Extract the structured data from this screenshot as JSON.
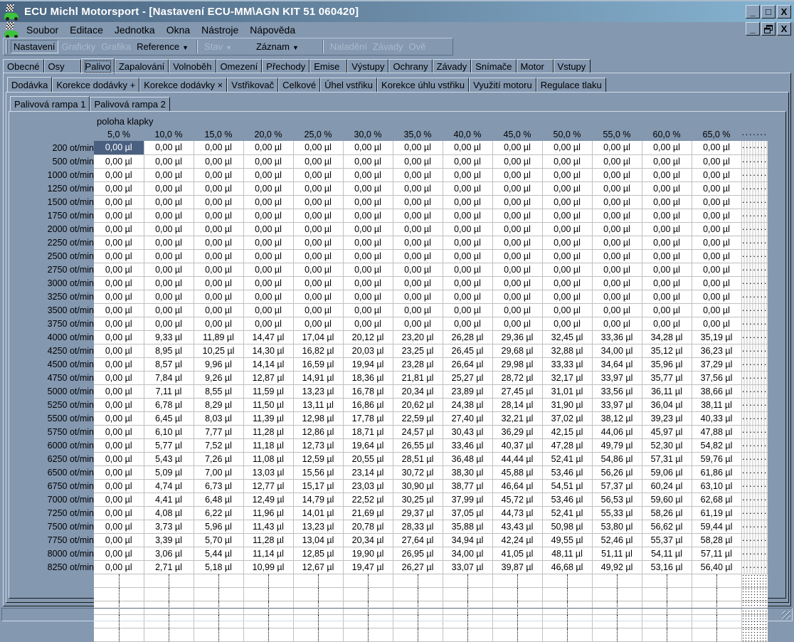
{
  "window": {
    "title": "ECU Michl Motorsport - [Nastavení ECU-MM\\AGN KIT 51 060420]",
    "controls": {
      "minimize": "_",
      "maximize": "□",
      "close": "X",
      "restore": "🗗"
    }
  },
  "menu": [
    "Soubor",
    "Editace",
    "Jednotka",
    "Okna",
    "Nástroje",
    "Nápověda"
  ],
  "toolbar": {
    "items": [
      {
        "label": "Nastavení",
        "state": "active"
      },
      {
        "label": "Graficky",
        "state": "disabled"
      },
      {
        "label": "Grafika",
        "state": "disabled"
      },
      {
        "label": "Reference",
        "state": "normal",
        "dropdown": true
      },
      {
        "label": "Stav",
        "state": "disabled",
        "dropdown": true
      },
      {
        "label": "Záznam",
        "state": "normal",
        "dropdown": true
      },
      {
        "label": "Naladění",
        "state": "disabled"
      },
      {
        "label": "Závady",
        "state": "disabled"
      },
      {
        "label": "Ově",
        "state": "disabled"
      }
    ],
    "dropdown_glyph": "▼"
  },
  "main_tabs": [
    "Obecné",
    "Osy",
    "Palivo",
    "Zapalování",
    "Volnoběh",
    "Omezení",
    "Přechody",
    "Emise",
    "Výstupy",
    "Ochrany",
    "Závady",
    "Snímače",
    "Motor",
    "Vstupy"
  ],
  "main_tab_active": "Palivo",
  "sub_tabs": [
    "Dodávka",
    "Korekce dodávky +",
    "Korekce dodávky ×",
    "Vstřikovač",
    "Celkové",
    "Úhel vstřiku",
    "Korekce úhlu vstřiku",
    "Využití motoru",
    "Regulace tlaku"
  ],
  "sub_tab_active": "Dodávka",
  "rail_tabs": [
    "Palivová rampa 1",
    "Palivová rampa 2"
  ],
  "rail_tab_active": "Palivová rampa 1",
  "table": {
    "column_axis_label": "poloha klapky",
    "columns": [
      "5,0 %",
      "10,0 %",
      "15,0 %",
      "20,0 %",
      "25,0 %",
      "30,0 %",
      "35,0 %",
      "40,0 %",
      "45,0 %",
      "50,0 %",
      "55,0 %",
      "60,0 %",
      "65,0 %"
    ],
    "more_columns_indicator": "·······",
    "more_rows_indicator": "⋮",
    "unit": "µl",
    "selected_cell": {
      "row": 0,
      "col": 0
    },
    "rows": [
      {
        "rpm": "200 ot/min",
        "values": [
          "0,00 µl",
          "0,00 µl",
          "0,00 µl",
          "0,00 µl",
          "0,00 µl",
          "0,00 µl",
          "0,00 µl",
          "0,00 µl",
          "0,00 µl",
          "0,00 µl",
          "0,00 µl",
          "0,00 µl",
          "0,00 µl"
        ]
      },
      {
        "rpm": "500 ot/min",
        "values": [
          "0,00 µl",
          "0,00 µl",
          "0,00 µl",
          "0,00 µl",
          "0,00 µl",
          "0,00 µl",
          "0,00 µl",
          "0,00 µl",
          "0,00 µl",
          "0,00 µl",
          "0,00 µl",
          "0,00 µl",
          "0,00 µl"
        ]
      },
      {
        "rpm": "1000 ot/min",
        "values": [
          "0,00 µl",
          "0,00 µl",
          "0,00 µl",
          "0,00 µl",
          "0,00 µl",
          "0,00 µl",
          "0,00 µl",
          "0,00 µl",
          "0,00 µl",
          "0,00 µl",
          "0,00 µl",
          "0,00 µl",
          "0,00 µl"
        ]
      },
      {
        "rpm": "1250 ot/min",
        "values": [
          "0,00 µl",
          "0,00 µl",
          "0,00 µl",
          "0,00 µl",
          "0,00 µl",
          "0,00 µl",
          "0,00 µl",
          "0,00 µl",
          "0,00 µl",
          "0,00 µl",
          "0,00 µl",
          "0,00 µl",
          "0,00 µl"
        ]
      },
      {
        "rpm": "1500 ot/min",
        "values": [
          "0,00 µl",
          "0,00 µl",
          "0,00 µl",
          "0,00 µl",
          "0,00 µl",
          "0,00 µl",
          "0,00 µl",
          "0,00 µl",
          "0,00 µl",
          "0,00 µl",
          "0,00 µl",
          "0,00 µl",
          "0,00 µl"
        ]
      },
      {
        "rpm": "1750 ot/min",
        "values": [
          "0,00 µl",
          "0,00 µl",
          "0,00 µl",
          "0,00 µl",
          "0,00 µl",
          "0,00 µl",
          "0,00 µl",
          "0,00 µl",
          "0,00 µl",
          "0,00 µl",
          "0,00 µl",
          "0,00 µl",
          "0,00 µl"
        ]
      },
      {
        "rpm": "2000 ot/min",
        "values": [
          "0,00 µl",
          "0,00 µl",
          "0,00 µl",
          "0,00 µl",
          "0,00 µl",
          "0,00 µl",
          "0,00 µl",
          "0,00 µl",
          "0,00 µl",
          "0,00 µl",
          "0,00 µl",
          "0,00 µl",
          "0,00 µl"
        ]
      },
      {
        "rpm": "2250 ot/min",
        "values": [
          "0,00 µl",
          "0,00 µl",
          "0,00 µl",
          "0,00 µl",
          "0,00 µl",
          "0,00 µl",
          "0,00 µl",
          "0,00 µl",
          "0,00 µl",
          "0,00 µl",
          "0,00 µl",
          "0,00 µl",
          "0,00 µl"
        ]
      },
      {
        "rpm": "2500 ot/min",
        "values": [
          "0,00 µl",
          "0,00 µl",
          "0,00 µl",
          "0,00 µl",
          "0,00 µl",
          "0,00 µl",
          "0,00 µl",
          "0,00 µl",
          "0,00 µl",
          "0,00 µl",
          "0,00 µl",
          "0,00 µl",
          "0,00 µl"
        ]
      },
      {
        "rpm": "2750 ot/min",
        "values": [
          "0,00 µl",
          "0,00 µl",
          "0,00 µl",
          "0,00 µl",
          "0,00 µl",
          "0,00 µl",
          "0,00 µl",
          "0,00 µl",
          "0,00 µl",
          "0,00 µl",
          "0,00 µl",
          "0,00 µl",
          "0,00 µl"
        ]
      },
      {
        "rpm": "3000 ot/min",
        "values": [
          "0,00 µl",
          "0,00 µl",
          "0,00 µl",
          "0,00 µl",
          "0,00 µl",
          "0,00 µl",
          "0,00 µl",
          "0,00 µl",
          "0,00 µl",
          "0,00 µl",
          "0,00 µl",
          "0,00 µl",
          "0,00 µl"
        ]
      },
      {
        "rpm": "3250 ot/min",
        "values": [
          "0,00 µl",
          "0,00 µl",
          "0,00 µl",
          "0,00 µl",
          "0,00 µl",
          "0,00 µl",
          "0,00 µl",
          "0,00 µl",
          "0,00 µl",
          "0,00 µl",
          "0,00 µl",
          "0,00 µl",
          "0,00 µl"
        ]
      },
      {
        "rpm": "3500 ot/min",
        "values": [
          "0,00 µl",
          "0,00 µl",
          "0,00 µl",
          "0,00 µl",
          "0,00 µl",
          "0,00 µl",
          "0,00 µl",
          "0,00 µl",
          "0,00 µl",
          "0,00 µl",
          "0,00 µl",
          "0,00 µl",
          "0,00 µl"
        ]
      },
      {
        "rpm": "3750 ot/min",
        "values": [
          "0,00 µl",
          "0,00 µl",
          "0,00 µl",
          "0,00 µl",
          "0,00 µl",
          "0,00 µl",
          "0,00 µl",
          "0,00 µl",
          "0,00 µl",
          "0,00 µl",
          "0,00 µl",
          "0,00 µl",
          "0,00 µl"
        ]
      },
      {
        "rpm": "4000 ot/min",
        "values": [
          "0,00 µl",
          "9,33 µl",
          "11,89 µl",
          "14,47 µl",
          "17,04 µl",
          "20,12 µl",
          "23,20 µl",
          "26,28 µl",
          "29,36 µl",
          "32,45 µl",
          "33,36 µl",
          "34,28 µl",
          "35,19 µl"
        ]
      },
      {
        "rpm": "4250 ot/min",
        "values": [
          "0,00 µl",
          "8,95 µl",
          "10,25 µl",
          "14,30 µl",
          "16,82 µl",
          "20,03 µl",
          "23,25 µl",
          "26,45 µl",
          "29,68 µl",
          "32,88 µl",
          "34,00 µl",
          "35,12 µl",
          "36,23 µl"
        ]
      },
      {
        "rpm": "4500 ot/min",
        "values": [
          "0,00 µl",
          "8,57 µl",
          "9,96 µl",
          "14,14 µl",
          "16,59 µl",
          "19,94 µl",
          "23,28 µl",
          "26,64 µl",
          "29,98 µl",
          "33,33 µl",
          "34,64 µl",
          "35,96 µl",
          "37,29 µl"
        ]
      },
      {
        "rpm": "4750 ot/min",
        "values": [
          "0,00 µl",
          "7,84 µl",
          "9,26 µl",
          "12,87 µl",
          "14,91 µl",
          "18,36 µl",
          "21,81 µl",
          "25,27 µl",
          "28,72 µl",
          "32,17 µl",
          "33,97 µl",
          "35,77 µl",
          "37,56 µl"
        ]
      },
      {
        "rpm": "5000 ot/min",
        "values": [
          "0,00 µl",
          "7,11 µl",
          "8,55 µl",
          "11,59 µl",
          "13,23 µl",
          "16,78 µl",
          "20,34 µl",
          "23,89 µl",
          "27,45 µl",
          "31,01 µl",
          "33,56 µl",
          "36,11 µl",
          "38,66 µl"
        ]
      },
      {
        "rpm": "5250 ot/min",
        "values": [
          "0,00 µl",
          "6,78 µl",
          "8,29 µl",
          "11,50 µl",
          "13,11 µl",
          "16,86 µl",
          "20,62 µl",
          "24,38 µl",
          "28,14 µl",
          "31,90 µl",
          "33,97 µl",
          "36,04 µl",
          "38,11 µl"
        ]
      },
      {
        "rpm": "5500 ot/min",
        "values": [
          "0,00 µl",
          "6,45 µl",
          "8,03 µl",
          "11,39 µl",
          "12,98 µl",
          "17,78 µl",
          "22,59 µl",
          "27,40 µl",
          "32,21 µl",
          "37,02 µl",
          "38,12 µl",
          "39,23 µl",
          "40,33 µl"
        ]
      },
      {
        "rpm": "5750 ot/min",
        "values": [
          "0,00 µl",
          "6,10 µl",
          "7,77 µl",
          "11,28 µl",
          "12,86 µl",
          "18,71 µl",
          "24,57 µl",
          "30,43 µl",
          "36,29 µl",
          "42,15 µl",
          "44,06 µl",
          "45,97 µl",
          "47,88 µl"
        ]
      },
      {
        "rpm": "6000 ot/min",
        "values": [
          "0,00 µl",
          "5,77 µl",
          "7,52 µl",
          "11,18 µl",
          "12,73 µl",
          "19,64 µl",
          "26,55 µl",
          "33,46 µl",
          "40,37 µl",
          "47,28 µl",
          "49,79 µl",
          "52,30 µl",
          "54,82 µl"
        ]
      },
      {
        "rpm": "6250 ot/min",
        "values": [
          "0,00 µl",
          "5,43 µl",
          "7,26 µl",
          "11,08 µl",
          "12,59 µl",
          "20,55 µl",
          "28,51 µl",
          "36,48 µl",
          "44,44 µl",
          "52,41 µl",
          "54,86 µl",
          "57,31 µl",
          "59,76 µl"
        ]
      },
      {
        "rpm": "6500 ot/min",
        "values": [
          "0,00 µl",
          "5,09 µl",
          "7,00 µl",
          "13,03 µl",
          "15,56 µl",
          "23,14 µl",
          "30,72 µl",
          "38,30 µl",
          "45,88 µl",
          "53,46 µl",
          "56,26 µl",
          "59,06 µl",
          "61,86 µl"
        ]
      },
      {
        "rpm": "6750 ot/min",
        "values": [
          "0,00 µl",
          "4,74 µl",
          "6,73 µl",
          "12,77 µl",
          "15,17 µl",
          "23,03 µl",
          "30,90 µl",
          "38,77 µl",
          "46,64 µl",
          "54,51 µl",
          "57,37 µl",
          "60,24 µl",
          "63,10 µl"
        ]
      },
      {
        "rpm": "7000 ot/min",
        "values": [
          "0,00 µl",
          "4,41 µl",
          "6,48 µl",
          "12,49 µl",
          "14,79 µl",
          "22,52 µl",
          "30,25 µl",
          "37,99 µl",
          "45,72 µl",
          "53,46 µl",
          "56,53 µl",
          "59,60 µl",
          "62,68 µl"
        ]
      },
      {
        "rpm": "7250 ot/min",
        "values": [
          "0,00 µl",
          "4,08 µl",
          "6,22 µl",
          "11,96 µl",
          "14,01 µl",
          "21,69 µl",
          "29,37 µl",
          "37,05 µl",
          "44,73 µl",
          "52,41 µl",
          "55,33 µl",
          "58,26 µl",
          "61,19 µl"
        ]
      },
      {
        "rpm": "7500 ot/min",
        "values": [
          "0,00 µl",
          "3,73 µl",
          "5,96 µl",
          "11,43 µl",
          "13,23 µl",
          "20,78 µl",
          "28,33 µl",
          "35,88 µl",
          "43,43 µl",
          "50,98 µl",
          "53,80 µl",
          "56,62 µl",
          "59,44 µl"
        ]
      },
      {
        "rpm": "7750 ot/min",
        "values": [
          "0,00 µl",
          "3,39 µl",
          "5,70 µl",
          "11,28 µl",
          "13,04 µl",
          "20,34 µl",
          "27,64 µl",
          "34,94 µl",
          "42,24 µl",
          "49,55 µl",
          "52,46 µl",
          "55,37 µl",
          "58,28 µl"
        ]
      },
      {
        "rpm": "8000 ot/min",
        "values": [
          "0,00 µl",
          "3,06 µl",
          "5,44 µl",
          "11,14 µl",
          "12,85 µl",
          "19,90 µl",
          "26,95 µl",
          "34,00 µl",
          "41,05 µl",
          "48,11 µl",
          "51,11 µl",
          "54,11 µl",
          "57,11 µl"
        ]
      },
      {
        "rpm": "8250 ot/min",
        "values": [
          "0,00 µl",
          "2,71 µl",
          "5,18 µl",
          "10,99 µl",
          "12,67 µl",
          "19,47 µl",
          "26,27 µl",
          "33,07 µl",
          "39,87 µl",
          "46,68 µl",
          "49,92 µl",
          "53,16 µl",
          "56,40 µl"
        ]
      }
    ]
  },
  "status_bar": {
    "text": ""
  }
}
